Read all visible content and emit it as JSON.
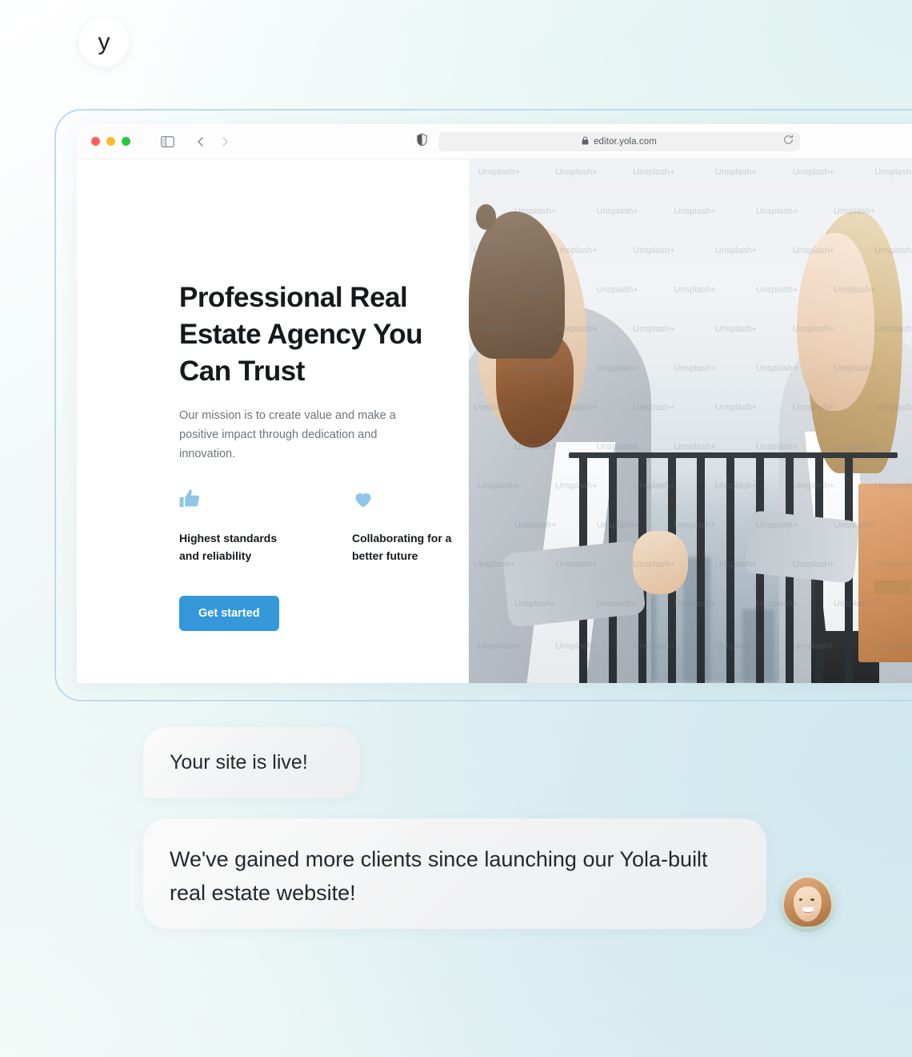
{
  "browser": {
    "window_controls": [
      "close",
      "minimize",
      "maximize"
    ],
    "sidebar_toggle_name": "sidebar-toggle-icon",
    "back_label": "Back",
    "forward_label": "Forward",
    "shield_name": "privacy-shield-icon",
    "url": "editor.yola.com",
    "lock_name": "lock-icon",
    "reload_name": "reload-icon"
  },
  "site": {
    "heading": "Professional Real Estate Agency You Can Trust",
    "subheading": "Our mission is to create value and make a positive impact through dedication and innovation.",
    "features": [
      {
        "icon": "thumbs-up-icon",
        "label": "Highest standards and reliability"
      },
      {
        "icon": "heart-icon",
        "label": "Collaborating for a better future"
      }
    ],
    "cta_label": "Get started",
    "photo": {
      "alt": "Two business people shaking hands on a city rooftop terrace",
      "watermark": "Unsplash+"
    }
  },
  "chat": {
    "messages": [
      {
        "avatar": "yola-logo-avatar",
        "avatar_text": "y",
        "text": "Your site is live!"
      },
      {
        "avatar": "customer-photo-avatar",
        "text": "We've gained more clients since launching our Yola-built real estate website!"
      }
    ]
  },
  "colors": {
    "accent_blue": "#3498db",
    "feature_icon_blue": "#8ec5e8",
    "frame_border": "#bcdcec",
    "heading_dark": "#16191c",
    "body_grey": "#6e7479",
    "bubble_grey": "#f1f2f3",
    "traffic_red": "#ff5f57",
    "traffic_yellow": "#febc2e",
    "traffic_green": "#28c840"
  }
}
